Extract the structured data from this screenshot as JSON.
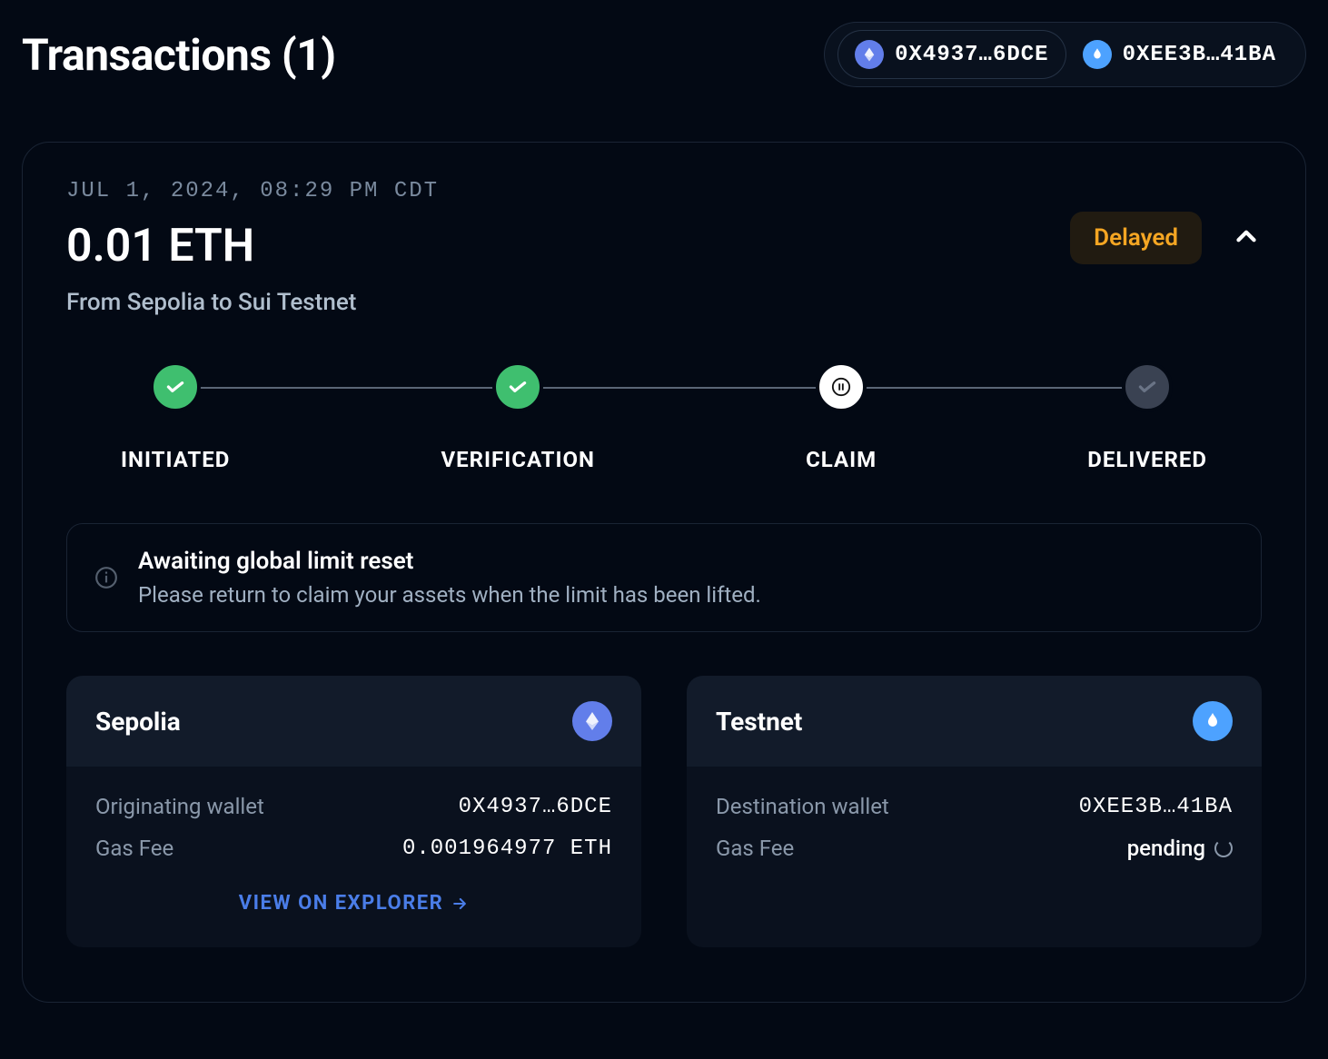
{
  "page_title": "Transactions (1)",
  "wallets": [
    {
      "chain": "eth",
      "address": "0X4937…6DCE"
    },
    {
      "chain": "sui",
      "address": "0XEE3B…41BA"
    }
  ],
  "tx": {
    "date": "JUL 1, 2024, 08:29 PM CDT",
    "amount": "0.01 ETH",
    "route": "From Sepolia to Sui Testnet",
    "status": "Delayed"
  },
  "steps": [
    {
      "label": "INITIATED",
      "state": "done"
    },
    {
      "label": "VERIFICATION",
      "state": "done"
    },
    {
      "label": "CLAIM",
      "state": "current"
    },
    {
      "label": "DELIVERED",
      "state": "pending"
    }
  ],
  "info": {
    "title": "Awaiting global limit reset",
    "desc": "Please return to claim your assets when the limit has been lifted."
  },
  "source": {
    "name": "Sepolia",
    "wallet_label": "Originating wallet",
    "wallet": "0X4937…6DCE",
    "gas_label": "Gas Fee",
    "gas": "0.001964977 ETH",
    "explorer": "VIEW ON EXPLORER"
  },
  "dest": {
    "name": "Testnet",
    "wallet_label": "Destination wallet",
    "wallet": "0XEE3B…41BA",
    "gas_label": "Gas Fee",
    "gas": "pending"
  }
}
